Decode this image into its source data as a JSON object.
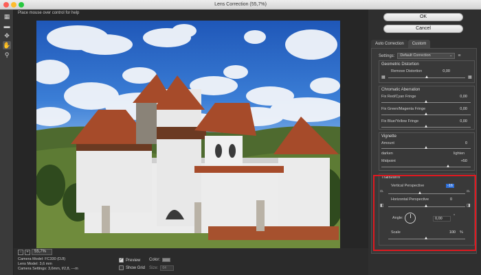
{
  "window": {
    "title": "Lens Correction (55,7%)"
  },
  "hint": "Place mouse over control for help",
  "tools": [
    {
      "name": "remove-distortion-tool-icon",
      "glyph": "▦"
    },
    {
      "name": "straighten-tool-icon",
      "glyph": "▬"
    },
    {
      "name": "move-grid-tool-icon",
      "glyph": "✥"
    },
    {
      "name": "hand-tool-icon",
      "glyph": "✋"
    },
    {
      "name": "zoom-tool-icon",
      "glyph": "⚲"
    }
  ],
  "footer": {
    "zoom_minus": "−",
    "zoom_plus": "+",
    "zoom_value": "55,7%",
    "camera_model": "Camera Model: FC330 (DJI)",
    "lens_model": "Lens Model: 3,6 mm",
    "camera_settings": "Camera Settings: 3,6mm, f/2,8, ---m",
    "preview_label": "Preview",
    "preview_checked": "✓",
    "show_grid_label": "Show Grid",
    "color_label": "Color:",
    "size_label": "Size:",
    "size_value": "64"
  },
  "buttons": {
    "ok": "OK",
    "cancel": "Cancel"
  },
  "tabs": [
    {
      "label": "Auto Correction"
    },
    {
      "label": "Custom"
    }
  ],
  "settings": {
    "label": "Settings:",
    "value": "Default Correction",
    "menu_icon": "≡"
  },
  "geometric": {
    "title": "Geometric Distortion",
    "remove_distortion": {
      "label": "Remove Distortion",
      "value": "0,00"
    }
  },
  "chromatic": {
    "title": "Chromatic Aberration",
    "rows": [
      {
        "label": "Fix Red/Cyan Fringe",
        "value": "0,00"
      },
      {
        "label": "Fix Green/Magenta Fringe",
        "value": "0,00"
      },
      {
        "label": "Fix Blue/Yellow Fringe",
        "value": "0,00"
      }
    ]
  },
  "vignette": {
    "title": "Vignette",
    "amount": {
      "label": "Amount",
      "value": "0"
    },
    "darken": "darken",
    "lighten": "lighten",
    "midpoint": {
      "label": "Midpoint",
      "value": "+50"
    }
  },
  "transform": {
    "title": "Transform",
    "vertical": {
      "label": "Vertical Perspective",
      "value": "-16"
    },
    "horizontal": {
      "label": "Horizontal Perspective",
      "value": "0"
    },
    "angle": {
      "label": "Angle:",
      "value": "0,00",
      "unit": "°"
    },
    "scale": {
      "label": "Scale",
      "value": "100",
      "unit": "%"
    }
  },
  "colors": {
    "highlight_box": "#e0181f",
    "accent": "#2e6fd8"
  }
}
